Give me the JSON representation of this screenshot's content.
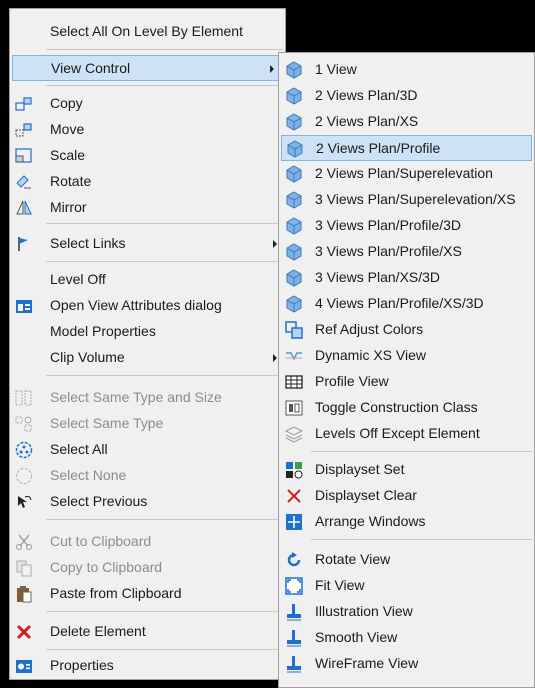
{
  "main_menu": {
    "items": [
      {
        "label": "Select All On Level By Element",
        "icon": "none"
      },
      {
        "label": "View Control",
        "icon": "none"
      },
      {
        "label": "Copy",
        "icon": "copy-icon"
      },
      {
        "label": "Move",
        "icon": "move-icon"
      },
      {
        "label": "Scale",
        "icon": "scale-icon"
      },
      {
        "label": "Rotate",
        "icon": "rotate-icon"
      },
      {
        "label": "Mirror",
        "icon": "mirror-icon"
      },
      {
        "label": "Select Links",
        "icon": "flag-icon"
      },
      {
        "label": "Level Off",
        "icon": "none"
      },
      {
        "label": "Open View Attributes dialog",
        "icon": "view-attributes-icon"
      },
      {
        "label": "Model Properties",
        "icon": "none"
      },
      {
        "label": "Clip Volume",
        "icon": "none"
      },
      {
        "label": "Select Same Type and Size",
        "icon": "select-same-size-icon"
      },
      {
        "label": "Select Same Type",
        "icon": "select-same-type-icon"
      },
      {
        "label": "Select All",
        "icon": "select-all-icon"
      },
      {
        "label": "Select None",
        "icon": "select-none-icon"
      },
      {
        "label": "Select Previous",
        "icon": "select-previous-icon"
      },
      {
        "label": "Cut to Clipboard",
        "icon": "scissors-icon"
      },
      {
        "label": "Copy to Clipboard",
        "icon": "copy-clipboard-icon"
      },
      {
        "label": "Paste from Clipboard",
        "icon": "paste-icon"
      },
      {
        "label": "Delete Element",
        "icon": "delete-x-icon"
      },
      {
        "label": "Properties",
        "icon": "properties-icon"
      }
    ]
  },
  "sub_menu": {
    "items": [
      {
        "label": "1 View",
        "icon": "cube-icon"
      },
      {
        "label": "2 Views Plan/3D",
        "icon": "cube-icon"
      },
      {
        "label": "2 Views Plan/XS",
        "icon": "cube-icon"
      },
      {
        "label": "2 Views Plan/Profile",
        "icon": "cube-icon"
      },
      {
        "label": "2 Views Plan/Superelevation",
        "icon": "cube-icon"
      },
      {
        "label": "3 Views Plan/Superelevation/XS",
        "icon": "cube-icon"
      },
      {
        "label": "3 Views Plan/Profile/3D",
        "icon": "cube-icon"
      },
      {
        "label": "3 Views Plan/Profile/XS",
        "icon": "cube-icon"
      },
      {
        "label": "3 Views Plan/XS/3D",
        "icon": "cube-icon"
      },
      {
        "label": "4 Views Plan/Profile/XS/3D",
        "icon": "cube-icon"
      },
      {
        "label": "Ref Adjust Colors",
        "icon": "ref-adjust-icon"
      },
      {
        "label": "Dynamic XS View",
        "icon": "dynamic-xs-icon"
      },
      {
        "label": "Profile View",
        "icon": "profile-grid-icon"
      },
      {
        "label": "Toggle Construction Class",
        "icon": "construction-class-icon"
      },
      {
        "label": "Levels Off Except Element",
        "icon": "levels-icon"
      },
      {
        "label": "Displayset Set",
        "icon": "displayset-set-icon"
      },
      {
        "label": "Displayset Clear",
        "icon": "displayset-clear-icon"
      },
      {
        "label": "Arrange Windows",
        "icon": "arrange-windows-icon"
      },
      {
        "label": "Rotate View",
        "icon": "rotate-view-icon"
      },
      {
        "label": "Fit View",
        "icon": "fit-view-icon"
      },
      {
        "label": "Illustration View",
        "icon": "illustration-view-icon"
      },
      {
        "label": "Smooth View",
        "icon": "smooth-view-icon"
      },
      {
        "label": "WireFrame View",
        "icon": "wireframe-view-icon"
      }
    ]
  },
  "colors": {
    "menu_bg": "#f0f0f0",
    "highlight": "#cde2f7",
    "highlight_border": "#84b1e6",
    "disabled_text": "#8c8c8c",
    "accent_blue": "#1e6fd0",
    "delete_red": "#d21f1f"
  }
}
